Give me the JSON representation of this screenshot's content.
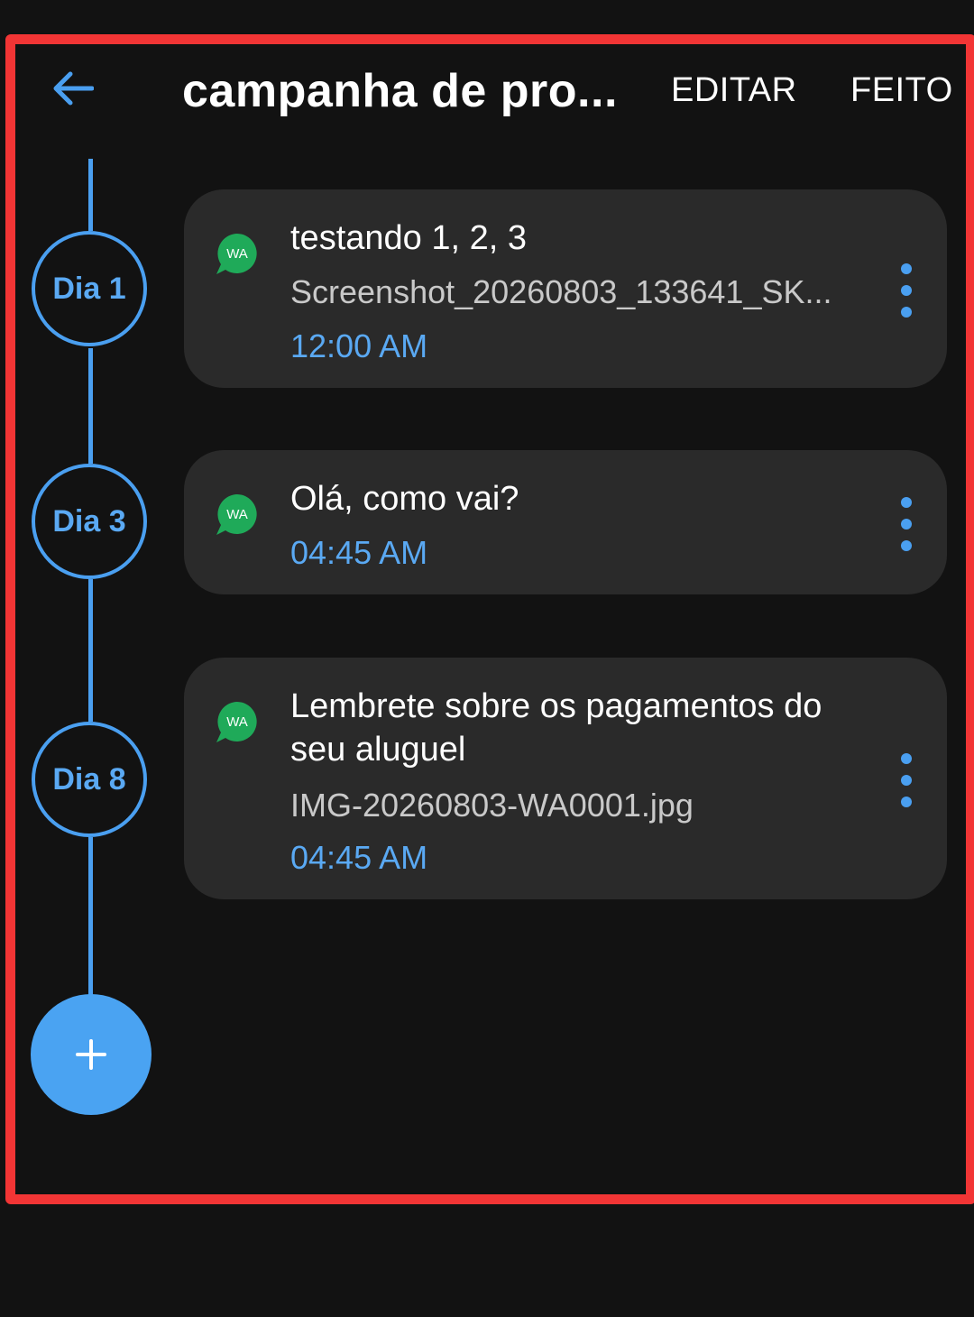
{
  "header": {
    "title": "campanha de pro...",
    "edit_label": "EDITAR",
    "done_label": "FEITO"
  },
  "timeline": {
    "days": [
      "Dia 1",
      "Dia 3",
      "Dia 8"
    ]
  },
  "messages": [
    {
      "channel_icon": "whatsapp-icon",
      "channel_label": "WA",
      "title": "testando 1, 2, 3",
      "attachment": "Screenshot_20260803_133641_SK...",
      "time": "12:00 AM"
    },
    {
      "channel_icon": "whatsapp-icon",
      "channel_label": "WA",
      "title": "Olá, como vai?",
      "time": "04:45 AM"
    },
    {
      "channel_icon": "whatsapp-icon",
      "channel_label": "WA",
      "title": "Lembrete sobre os pagamentos do seu aluguel",
      "attachment": "IMG-20260803-WA0001.jpg",
      "time": "04:45 AM"
    }
  ],
  "fab": {
    "icon": "plus-icon",
    "label": "+"
  },
  "colors": {
    "background": "#121212",
    "card": "#2a2a2a",
    "accent": "#4a9ff0",
    "whatsapp": "#1faa59",
    "highlight": "#f23535"
  }
}
